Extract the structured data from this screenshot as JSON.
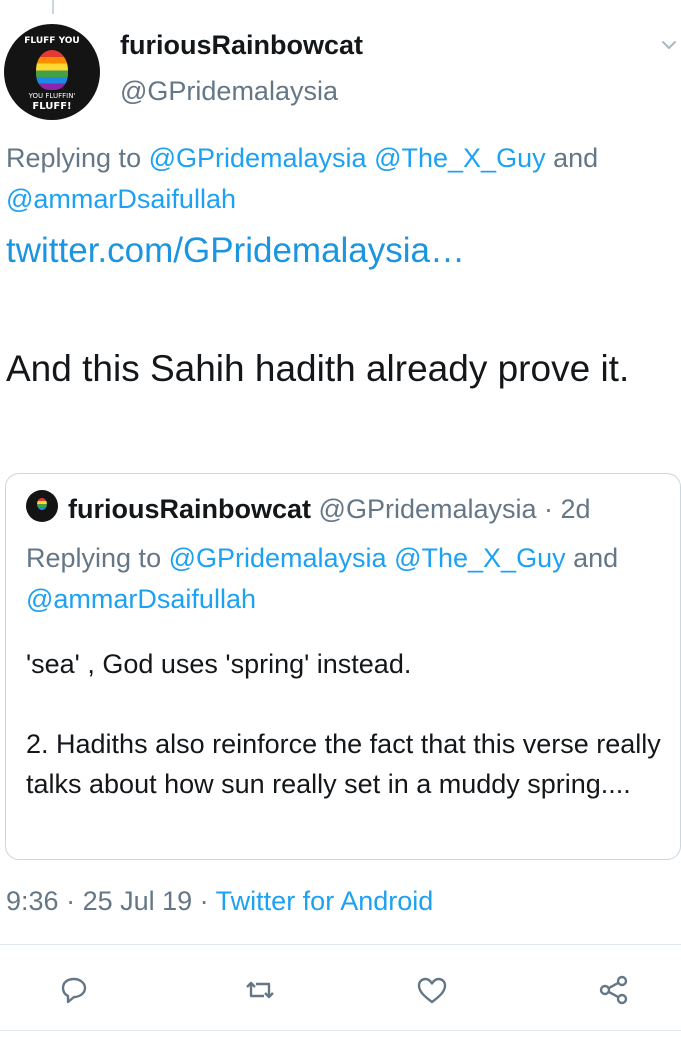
{
  "tweet": {
    "display_name": "furiousRainbowcat",
    "handle": "@GPridemalaysia",
    "avatar_text_top": "FLUFF YOU",
    "avatar_text_bottom_1": "YOU FLUFFIN'",
    "avatar_text_bottom_2": "FLUFF!",
    "reply_prefix": "Replying to ",
    "reply_mention_1": "@GPridemalaysia",
    "reply_mention_2": "@The_X_Guy",
    "reply_and": " and ",
    "reply_mention_3": "@ammarDsaifullah",
    "link_text": "twitter.com/GPridemalaysia…",
    "body": "And this Sahih hadith already prove it.",
    "time": "9:36",
    "date": "25 Jul 19",
    "client": "Twitter for Android"
  },
  "quoted": {
    "display_name": "furiousRainbowcat",
    "handle": "@GPridemalaysia",
    "age": "2d",
    "reply_prefix": "Replying to ",
    "reply_mention_1": "@GPridemalaysia",
    "reply_mention_2": "@The_X_Guy",
    "reply_and": " and ",
    "reply_mention_3": "@ammarDsaifullah",
    "text_para_1": "'sea' , God uses 'spring' instead.",
    "text_para_2": "2. Hadiths also reinforce the fact that this verse really talks about how sun really set in a muddy spring...."
  },
  "icons": {
    "menu": "chevron-down-icon",
    "reply": "reply-bubble-icon",
    "retweet": "retweet-icon",
    "like": "heart-icon",
    "share": "share-icon"
  },
  "colors": {
    "accent": "#1da1f2",
    "secondary_text": "#657786",
    "primary_text": "#14171a",
    "border": "#ccd6dd"
  }
}
